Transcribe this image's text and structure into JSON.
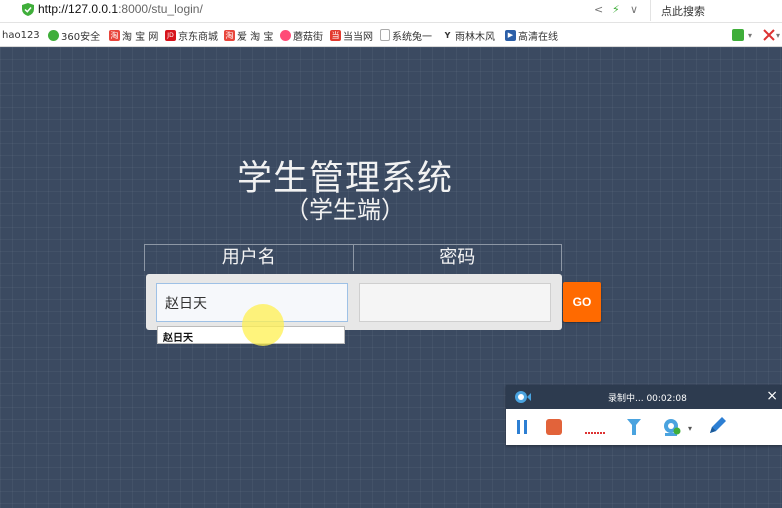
{
  "browser": {
    "url_host": "http://127.0.0.1",
    "url_path": ":8000/stu_login/",
    "search_placeholder": "点此搜索",
    "bookmarks": [
      {
        "label": "hao123",
        "icon": "hao123-icon",
        "color": "#2b7be4",
        "glyph": ""
      },
      {
        "label": "360安全",
        "icon": "360-icon",
        "color": "#3fae3a",
        "glyph": ""
      },
      {
        "label": "淘 宝 网",
        "icon": "taobao-icon",
        "color": "#e8463c",
        "glyph": "淘"
      },
      {
        "label": "京东商城",
        "icon": "jd-icon",
        "color": "#d7141c",
        "glyph": "JD"
      },
      {
        "label": "爱 淘 宝",
        "icon": "aitaobao-icon",
        "color": "#e8463c",
        "glyph": "淘"
      },
      {
        "label": "蘑菇街",
        "icon": "mogujie-icon",
        "color": "#ff4b77",
        "glyph": ""
      },
      {
        "label": "当当网",
        "icon": "dangdang-icon",
        "color": "#e33b2f",
        "glyph": "当"
      },
      {
        "label": "系统兔一",
        "icon": "page-icon",
        "color": "#ffffff",
        "glyph": ""
      },
      {
        "label": "雨林木风",
        "icon": "ylmf-icon",
        "color": "#ffffff",
        "glyph": "Y"
      },
      {
        "label": "高清在线",
        "icon": "video-icon",
        "color": "#2c5fa8",
        "glyph": "▶"
      }
    ]
  },
  "page": {
    "title": "学生管理系统",
    "subtitle": "（学生端）",
    "username_header": "用户名",
    "password_header": "密码",
    "username_value": "赵日天",
    "password_value": "",
    "go_label": "GO",
    "autocomplete_suggestion": "赵日天"
  },
  "recorder": {
    "status": "录制中... 00:02:08",
    "close": "×"
  }
}
